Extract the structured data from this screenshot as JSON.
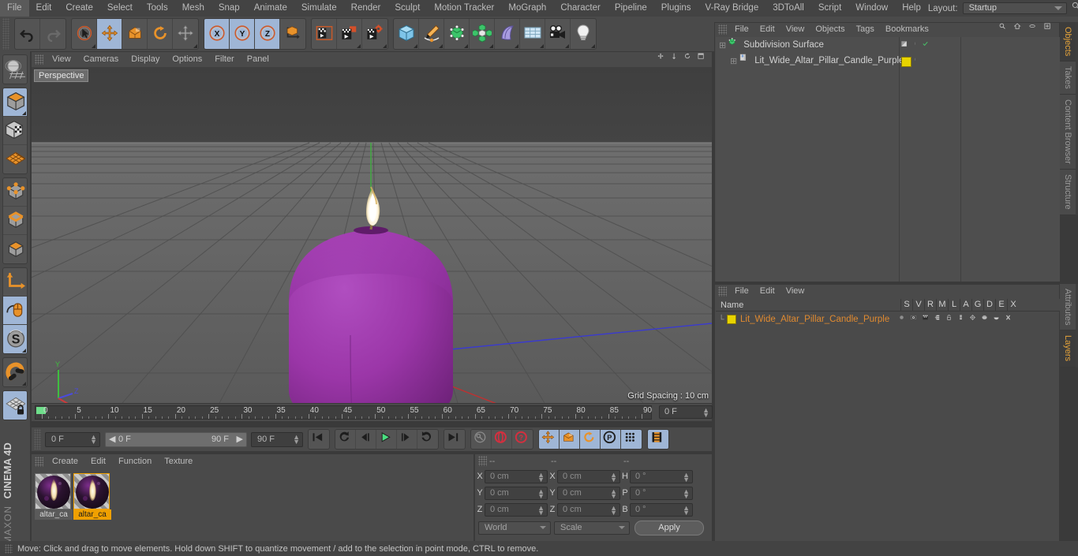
{
  "app": {
    "brand_top": "MAXON",
    "brand_bottom": "CINEMA 4D"
  },
  "menubar": {
    "items": [
      "File",
      "Edit",
      "Create",
      "Select",
      "Tools",
      "Mesh",
      "Snap",
      "Animate",
      "Simulate",
      "Render",
      "Sculpt",
      "Motion Tracker",
      "MoGraph",
      "Character",
      "Pipeline",
      "Plugins",
      "V-Ray Bridge",
      "3DToAll",
      "Script",
      "Window",
      "Help"
    ],
    "layout_label": "Layout:",
    "layout_value": "Startup",
    "search_icon": "magnifier-icon"
  },
  "toolbar": {
    "groups": [
      {
        "name": "undo-redo",
        "buttons": [
          {
            "icon": "undo-icon",
            "label": "Undo",
            "active": false,
            "corner": false
          },
          {
            "icon": "redo-icon",
            "label": "Redo",
            "active": false,
            "corner": false
          }
        ]
      },
      {
        "name": "transform-tools",
        "buttons": [
          {
            "icon": "select-cursor-icon",
            "label": "Live Selection",
            "active": false,
            "corner": true
          },
          {
            "icon": "move-icon",
            "label": "Move",
            "active": true,
            "corner": false
          },
          {
            "icon": "scale-icon",
            "label": "Scale",
            "active": false,
            "corner": false
          },
          {
            "icon": "rotate-icon",
            "label": "Rotate",
            "active": false,
            "corner": false
          },
          {
            "icon": "move-axis-icon",
            "label": "Move Tool Variant",
            "active": false,
            "corner": true
          }
        ]
      },
      {
        "name": "axis-locks",
        "buttons": [
          {
            "icon": "x-axis-icon",
            "label": "X",
            "active": true,
            "corner": false
          },
          {
            "icon": "y-axis-icon",
            "label": "Y",
            "active": true,
            "corner": false
          },
          {
            "icon": "z-axis-icon",
            "label": "Z",
            "active": true,
            "corner": false
          },
          {
            "icon": "world-object-axis-icon",
            "label": "World/Object",
            "active": false,
            "corner": false
          }
        ]
      },
      {
        "name": "render-tools",
        "buttons": [
          {
            "icon": "render-view-icon",
            "label": "Render View",
            "active": false,
            "corner": false
          },
          {
            "icon": "render-picture-viewer-icon",
            "label": "Render to Picture Viewer",
            "active": false,
            "corner": true
          },
          {
            "icon": "render-settings-icon",
            "label": "Edit Render Settings",
            "active": false,
            "corner": true
          }
        ]
      },
      {
        "name": "create-objects",
        "buttons": [
          {
            "icon": "cube-primitive-icon",
            "label": "Add Cube Object",
            "active": false,
            "corner": true
          },
          {
            "icon": "pen-spline-icon",
            "label": "Add Spline",
            "active": false,
            "corner": true
          },
          {
            "icon": "nurbs-generator-icon",
            "label": "Add Generator",
            "active": false,
            "corner": true
          },
          {
            "icon": "array-mograph-icon",
            "label": "Add Modeling Object",
            "active": false,
            "corner": true
          },
          {
            "icon": "bend-deformer-icon",
            "label": "Add Deformer",
            "active": false,
            "corner": true
          },
          {
            "icon": "floor-environment-icon",
            "label": "Add Scene Object",
            "active": false,
            "corner": true
          },
          {
            "icon": "camera-icon",
            "label": "Add Camera",
            "active": false,
            "corner": true
          },
          {
            "icon": "light-icon",
            "label": "Add Light",
            "active": false,
            "corner": true
          }
        ]
      }
    ]
  },
  "leftbar": {
    "groups": [
      {
        "buttons": [
          {
            "icon": "world-grid-icon",
            "label": "Make Editable",
            "active": false,
            "corner": false
          }
        ]
      },
      {
        "buttons": [
          {
            "icon": "model-mode-icon",
            "label": "Model Mode",
            "active": true,
            "corner": true
          },
          {
            "icon": "texture-mode-icon",
            "label": "Texture Mode",
            "active": false,
            "corner": false
          },
          {
            "icon": "workplane-icon",
            "label": "Workplane",
            "active": false,
            "corner": false
          }
        ]
      },
      {
        "buttons": [
          {
            "icon": "points-mode-icon",
            "label": "Points Mode",
            "active": false,
            "corner": false
          },
          {
            "icon": "edges-mode-icon",
            "label": "Edges Mode",
            "active": false,
            "corner": false
          },
          {
            "icon": "polygons-mode-icon",
            "label": "Polygons Mode",
            "active": false,
            "corner": false
          }
        ]
      },
      {
        "buttons": [
          {
            "icon": "axis-modify-icon",
            "label": "Enable Axis Modification",
            "active": false,
            "corner": false
          },
          {
            "icon": "viewport-solo-icon",
            "label": "Enable Snapping",
            "active": true,
            "corner": false
          },
          {
            "icon": "soft-selection-icon",
            "label": "Soft Selection",
            "active": true,
            "corner": true
          }
        ]
      },
      {
        "buttons": [
          {
            "icon": "magnet-icon",
            "label": "Magnet",
            "active": false,
            "corner": true
          }
        ]
      },
      {
        "buttons": [
          {
            "icon": "lock-grid-icon",
            "label": "Lock Workplane",
            "active": true,
            "corner": false
          }
        ]
      }
    ]
  },
  "viewport": {
    "menu": [
      "View",
      "Cameras",
      "Display",
      "Options",
      "Filter",
      "Panel"
    ],
    "view_label": "Perspective",
    "grid_spacing": "Grid Spacing : 10 cm",
    "axis_gizmo": {
      "x": "X",
      "y": "Y",
      "z": "Z"
    },
    "object_color": "#9B36A8",
    "flame_color": "#FFFFFF",
    "icons": [
      "pan-icon",
      "zoom-icon",
      "rotate-view-icon",
      "maximize-view-icon"
    ]
  },
  "timeline": {
    "ticks": [
      0,
      5,
      10,
      15,
      20,
      25,
      30,
      35,
      40,
      45,
      50,
      55,
      60,
      65,
      70,
      75,
      80,
      85,
      90
    ],
    "current_frame_field": "0 F",
    "start_field": "0 F",
    "range_start": "0 F",
    "range_end": "90 F",
    "end_field": "90 F"
  },
  "transport": {
    "buttons": [
      {
        "icon": "go-to-start-icon",
        "label": "Go to Start",
        "active": false
      },
      {
        "icon": "previous-key-icon",
        "label": "Go to Previous Key",
        "active": false
      },
      {
        "icon": "step-back-icon",
        "label": "Go to Previous Frame",
        "active": false
      },
      {
        "icon": "play-icon",
        "label": "Play Forwards",
        "active": false
      },
      {
        "icon": "step-forward-icon",
        "label": "Go to Next Frame",
        "active": false
      },
      {
        "icon": "next-key-icon",
        "label": "Go to Next Key",
        "active": false
      },
      {
        "icon": "go-to-end-icon",
        "label": "Go to End",
        "active": false
      }
    ],
    "record_buttons": [
      {
        "icon": "autokey-key-icon",
        "label": "Record Active Objects",
        "active": false
      },
      {
        "icon": "autokeying-icon",
        "label": "Autokeying",
        "active": false
      },
      {
        "icon": "keyframe-selection-icon",
        "label": "Keyframe Selection",
        "active": false
      }
    ],
    "param_buttons": [
      {
        "icon": "position-key-icon",
        "label": "Position",
        "active": true
      },
      {
        "icon": "scale-key-icon",
        "label": "Scale",
        "active": true
      },
      {
        "icon": "rotation-key-icon",
        "label": "Rotation",
        "active": true
      },
      {
        "icon": "pla-key-icon",
        "label": "Point Level Animation",
        "active": true
      },
      {
        "icon": "parameter-key-icon",
        "label": "Parameter",
        "active": true
      }
    ],
    "last_button": {
      "icon": "timeline-filmstrip-icon",
      "label": "Animation Mode",
      "active": true
    }
  },
  "materials": {
    "menu": [
      "Create",
      "Edit",
      "Function",
      "Texture"
    ],
    "items": [
      {
        "label": "altar_ca",
        "selected": false
      },
      {
        "label": "altar_ca",
        "selected": true
      }
    ]
  },
  "coordinates": {
    "header": [
      "--",
      "--",
      "--"
    ],
    "rows": [
      {
        "l1": "X",
        "v1": "0 cm",
        "l2": "X",
        "v2": "0 cm",
        "l3": "H",
        "v3": "0 °"
      },
      {
        "l1": "Y",
        "v1": "0 cm",
        "l2": "Y",
        "v2": "0 cm",
        "l3": "P",
        "v3": "0 °"
      },
      {
        "l1": "Z",
        "v1": "0 cm",
        "l2": "Z",
        "v2": "0 cm",
        "l3": "B",
        "v3": "0 °"
      }
    ],
    "system": "World",
    "mode": "Scale",
    "apply": "Apply"
  },
  "object_manager": {
    "menu": [
      "File",
      "Edit",
      "View",
      "Objects",
      "Tags",
      "Bookmarks"
    ],
    "icons": [
      "search-icon",
      "home-icon",
      "oval-icon",
      "new-layout-icon"
    ],
    "rows": [
      {
        "name": "Subdivision Surface",
        "icon": "subdivision-surface-icon",
        "indent": 0,
        "tag": "gradient-tag",
        "check": true,
        "tag_color": "#8a8a8a"
      },
      {
        "name": "Lit_Wide_Altar_Pillar_Candle_Purple",
        "icon": "polygon-object-icon",
        "indent": 1,
        "tag": "material-tag",
        "check": false,
        "tag_color": "#e8d400"
      }
    ]
  },
  "layer_manager": {
    "menu": [
      "File",
      "Edit",
      "View"
    ],
    "name_header": "Name",
    "columns": [
      "S",
      "V",
      "R",
      "M",
      "L",
      "A",
      "G",
      "D",
      "E",
      "X"
    ],
    "row": {
      "name": "Lit_Wide_Altar_Pillar_Candle_Purple",
      "swatch": "#e8d400",
      "cells": [
        "solo-dot-icon",
        "visible-eye-icon",
        "render-clapper-icon",
        "manager-icon",
        "lock-icon",
        "animation-icon",
        "generator-icon",
        "deformer-icon",
        "expression-icon",
        "xref-icon"
      ]
    }
  },
  "vtabs_top": [
    {
      "label": "Objects",
      "active": true
    },
    {
      "label": "Takes",
      "active": false
    },
    {
      "label": "Content Browser",
      "active": false
    },
    {
      "label": "Structure",
      "active": false
    }
  ],
  "vtabs_bottom": [
    {
      "label": "Attributes",
      "active": false
    },
    {
      "label": "Layers",
      "active": true
    }
  ],
  "statusbar": {
    "message": "Move: Click and drag to move elements. Hold down SHIFT to quantize movement / add to the selection in point mode, CTRL to remove."
  }
}
